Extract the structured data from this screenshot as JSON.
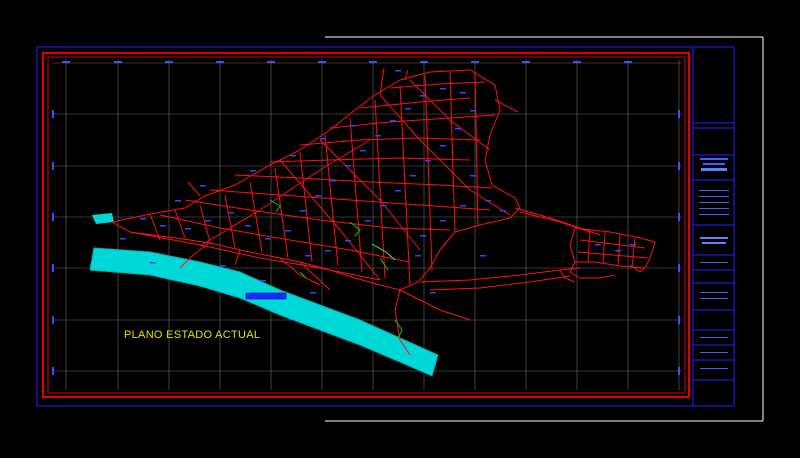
{
  "drawing": {
    "title": "PLANO ESTADO ACTUAL"
  },
  "colors": {
    "background": "#000000",
    "frame_red": "#e00000",
    "frame_blue": "#2020ff",
    "sheet_white": "#ffffff",
    "grid_gray": "#707070",
    "streets_red": "#ff0000",
    "block_labels_blue": "#3333ff",
    "beach_cyan": "#00d8d8",
    "parks_green": "#00cc00",
    "title_yellow": "#e8e000"
  },
  "icons": [
    "map-sheet",
    "street-network",
    "beach-strip",
    "title-block"
  ]
}
